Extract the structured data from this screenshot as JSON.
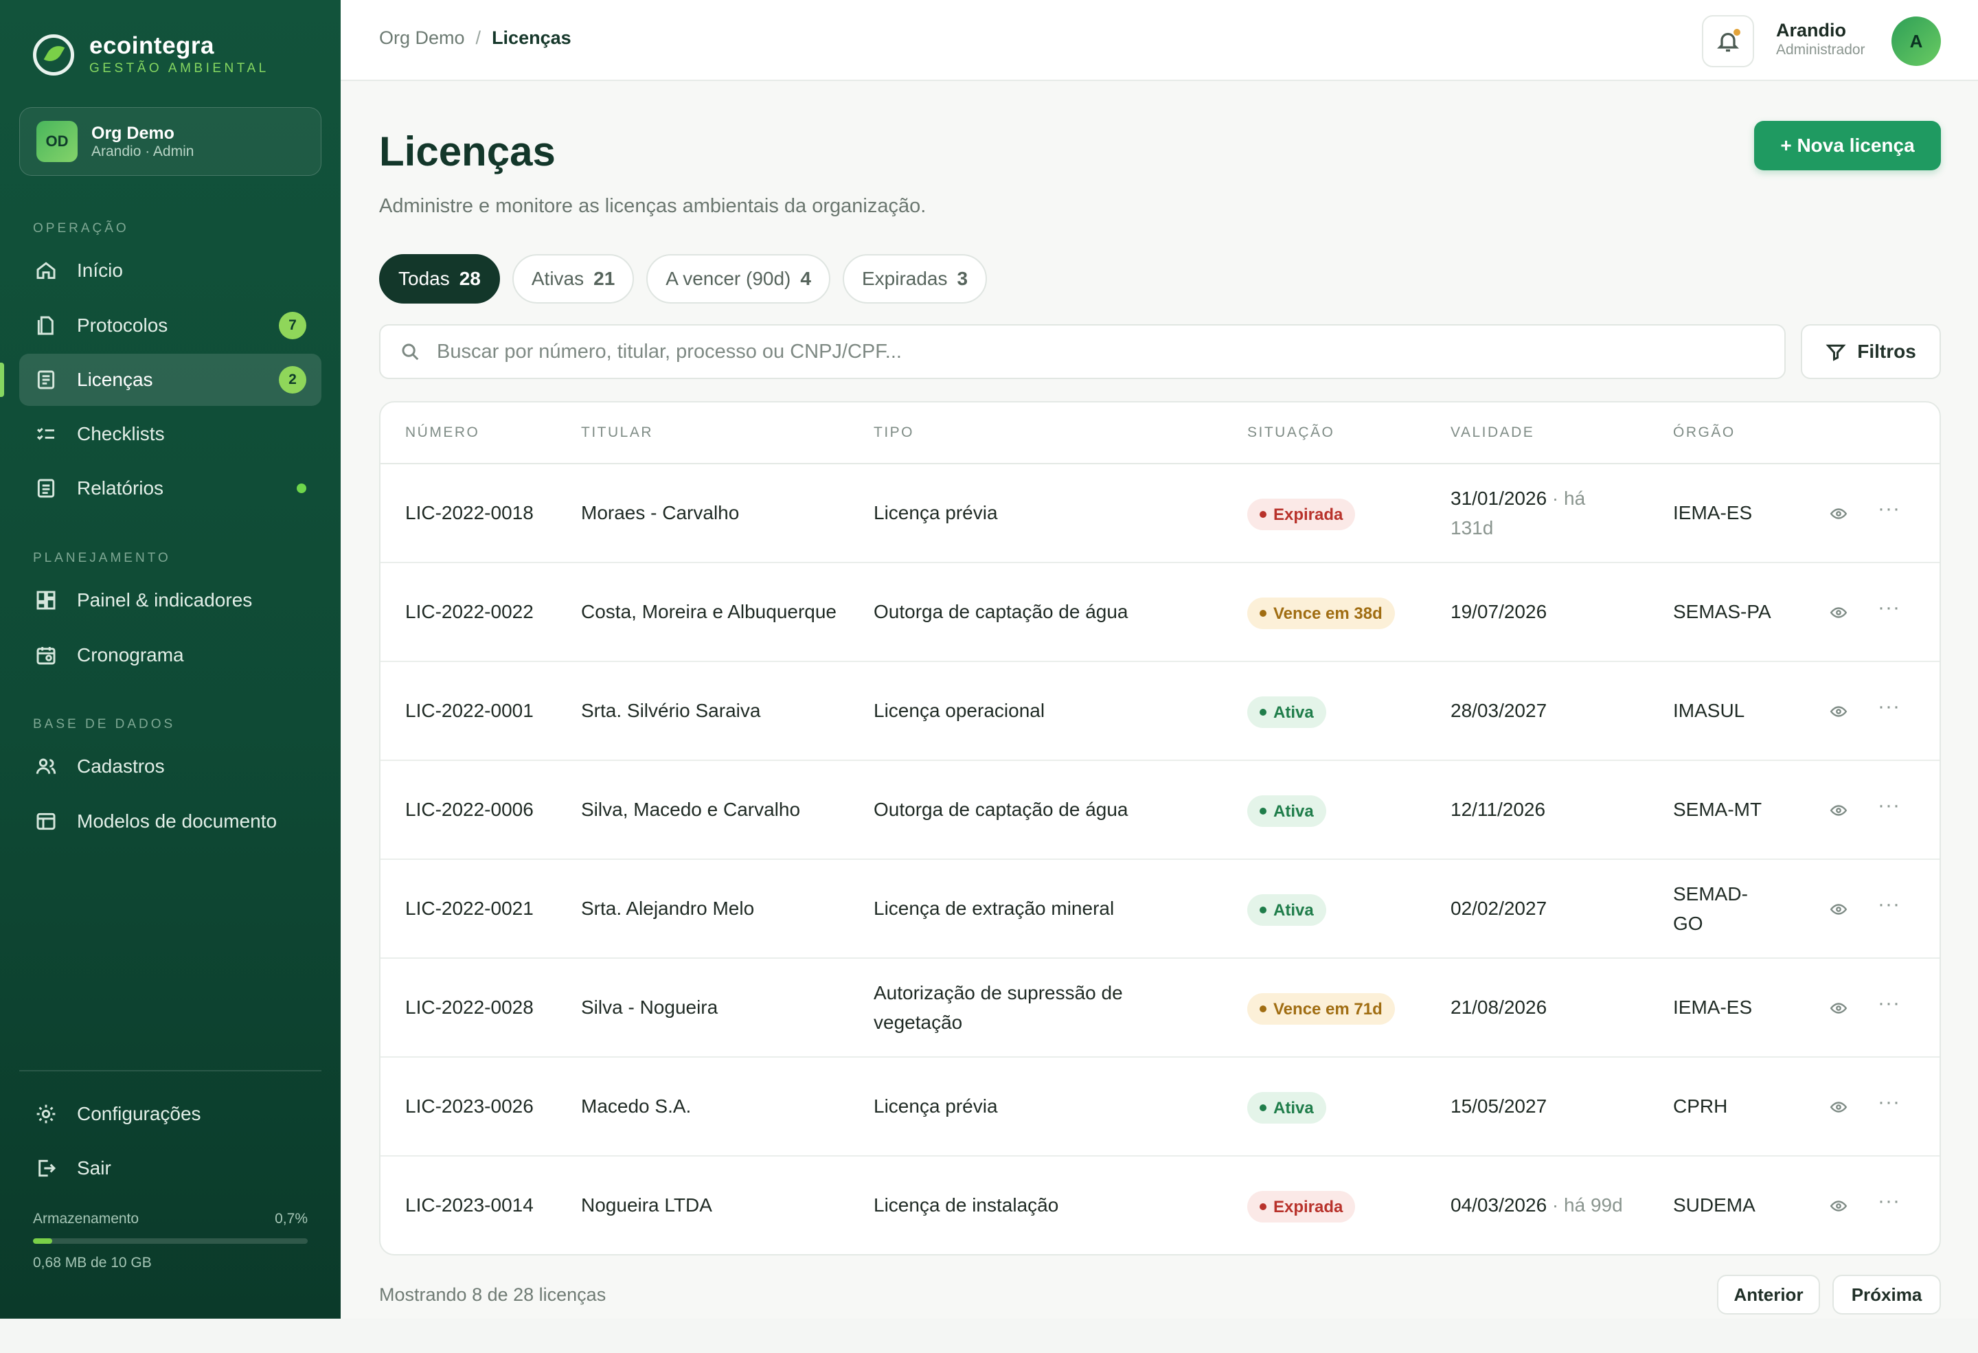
{
  "brand": {
    "name": "ecointegra",
    "tagline": "GESTÃO AMBIENTAL"
  },
  "org": {
    "initials": "OD",
    "name": "Org Demo",
    "sub": "Arandio · Admin"
  },
  "sidebar": {
    "sections": {
      "operacao": "OPERAÇÃO",
      "planejamento": "PLANEJAMENTO",
      "base": "BASE DE DADOS"
    },
    "items": [
      {
        "label": "Início",
        "icon": "home-icon"
      },
      {
        "label": "Protocolos",
        "icon": "document-icon",
        "badge": "7"
      },
      {
        "label": "Licenças",
        "icon": "license-icon",
        "badge": "2",
        "active": true
      },
      {
        "label": "Checklists",
        "icon": "checklist-icon"
      },
      {
        "label": "Relatórios",
        "icon": "report-icon",
        "dot": true
      },
      {
        "label": "Painel & indicadores",
        "icon": "dashboard-icon"
      },
      {
        "label": "Cronograma",
        "icon": "calendar-icon"
      },
      {
        "label": "Cadastros",
        "icon": "users-icon"
      },
      {
        "label": "Modelos de documento",
        "icon": "template-icon"
      },
      {
        "label": "Configurações",
        "icon": "gear-icon"
      },
      {
        "label": "Sair",
        "icon": "logout-icon"
      }
    ],
    "storage": {
      "label": "Armazenamento",
      "percent": "0,7%",
      "fraction": 0.007,
      "sub": "0,68 MB de 10 GB"
    }
  },
  "header": {
    "crumb_root": "Org Demo",
    "crumb_current": "Licenças",
    "user_name": "Arandio",
    "user_role": "Administrador",
    "user_initial": "A"
  },
  "page": {
    "title": "Licenças",
    "subtitle": "Administre e monitore as licenças ambientais da organização.",
    "new_button": "+ Nova licença"
  },
  "tabs": [
    {
      "label": "Todas",
      "count": "28"
    },
    {
      "label": "Ativas",
      "count": "21"
    },
    {
      "label": "A vencer (90d)",
      "count": "4"
    },
    {
      "label": "Expiradas",
      "count": "3"
    }
  ],
  "search": {
    "placeholder": "Buscar por número, titular, processo ou CNPJ/CPF..."
  },
  "filters_label": "Filtros",
  "table": {
    "headers": [
      "NÚMERO",
      "TITULAR",
      "TIPO",
      "SITUAÇÃO",
      "VALIDADE",
      "ÓRGÃO"
    ],
    "rows": [
      {
        "num": "LIC-2022-0018",
        "titular": "Moraes - Carvalho",
        "tipo": "Licença prévia",
        "sit": "Expirada",
        "sit_kind": "red",
        "val": "31/01/2026",
        "val_meta": " · há 131d",
        "org": "IEMA-ES"
      },
      {
        "num": "LIC-2022-0022",
        "titular": "Costa, Moreira e Albuquerque",
        "tipo": "Outorga de captação de água",
        "sit": "Vence em 38d",
        "sit_kind": "amber",
        "val": "19/07/2026",
        "val_meta": "",
        "org": "SEMAS-PA"
      },
      {
        "num": "LIC-2022-0001",
        "titular": "Srta. Silvério Saraiva",
        "tipo": "Licença operacional",
        "sit": "Ativa",
        "sit_kind": "green",
        "val": "28/03/2027",
        "val_meta": "",
        "org": "IMASUL"
      },
      {
        "num": "LIC-2022-0006",
        "titular": "Silva, Macedo e Carvalho",
        "tipo": "Outorga de captação de água",
        "sit": "Ativa",
        "sit_kind": "green",
        "val": "12/11/2026",
        "val_meta": "",
        "org": "SEMA-MT"
      },
      {
        "num": "LIC-2022-0021",
        "titular": "Srta. Alejandro Melo",
        "tipo": "Licença de extração mineral",
        "sit": "Ativa",
        "sit_kind": "green",
        "val": "02/02/2027",
        "val_meta": "",
        "org": "SEMAD-GO"
      },
      {
        "num": "LIC-2022-0028",
        "titular": "Silva - Nogueira",
        "tipo": "Autorização de supressão de vegetação",
        "sit": "Vence em 71d",
        "sit_kind": "amber",
        "val": "21/08/2026",
        "val_meta": "",
        "org": "IEMA-ES"
      },
      {
        "num": "LIC-2023-0026",
        "titular": "Macedo S.A.",
        "tipo": "Licença prévia",
        "sit": "Ativa",
        "sit_kind": "green",
        "val": "15/05/2027",
        "val_meta": "",
        "org": "CPRH"
      },
      {
        "num": "LIC-2023-0014",
        "titular": "Nogueira LTDA",
        "tipo": "Licença de instalação",
        "sit": "Expirada",
        "sit_kind": "red",
        "val": "04/03/2026",
        "val_meta": " · há 99d",
        "org": "SUDEMA"
      }
    ]
  },
  "footer": {
    "showing": "Mostrando 8 de 28 licenças",
    "prev": "Anterior",
    "next": "Próxima"
  },
  "colors": {
    "sidebar": "#12533b",
    "accent": "#1f9a61",
    "badge": "#8fd65a",
    "expired": "#b8322b",
    "warning": "#a06d12",
    "active": "#1f7d4a"
  }
}
